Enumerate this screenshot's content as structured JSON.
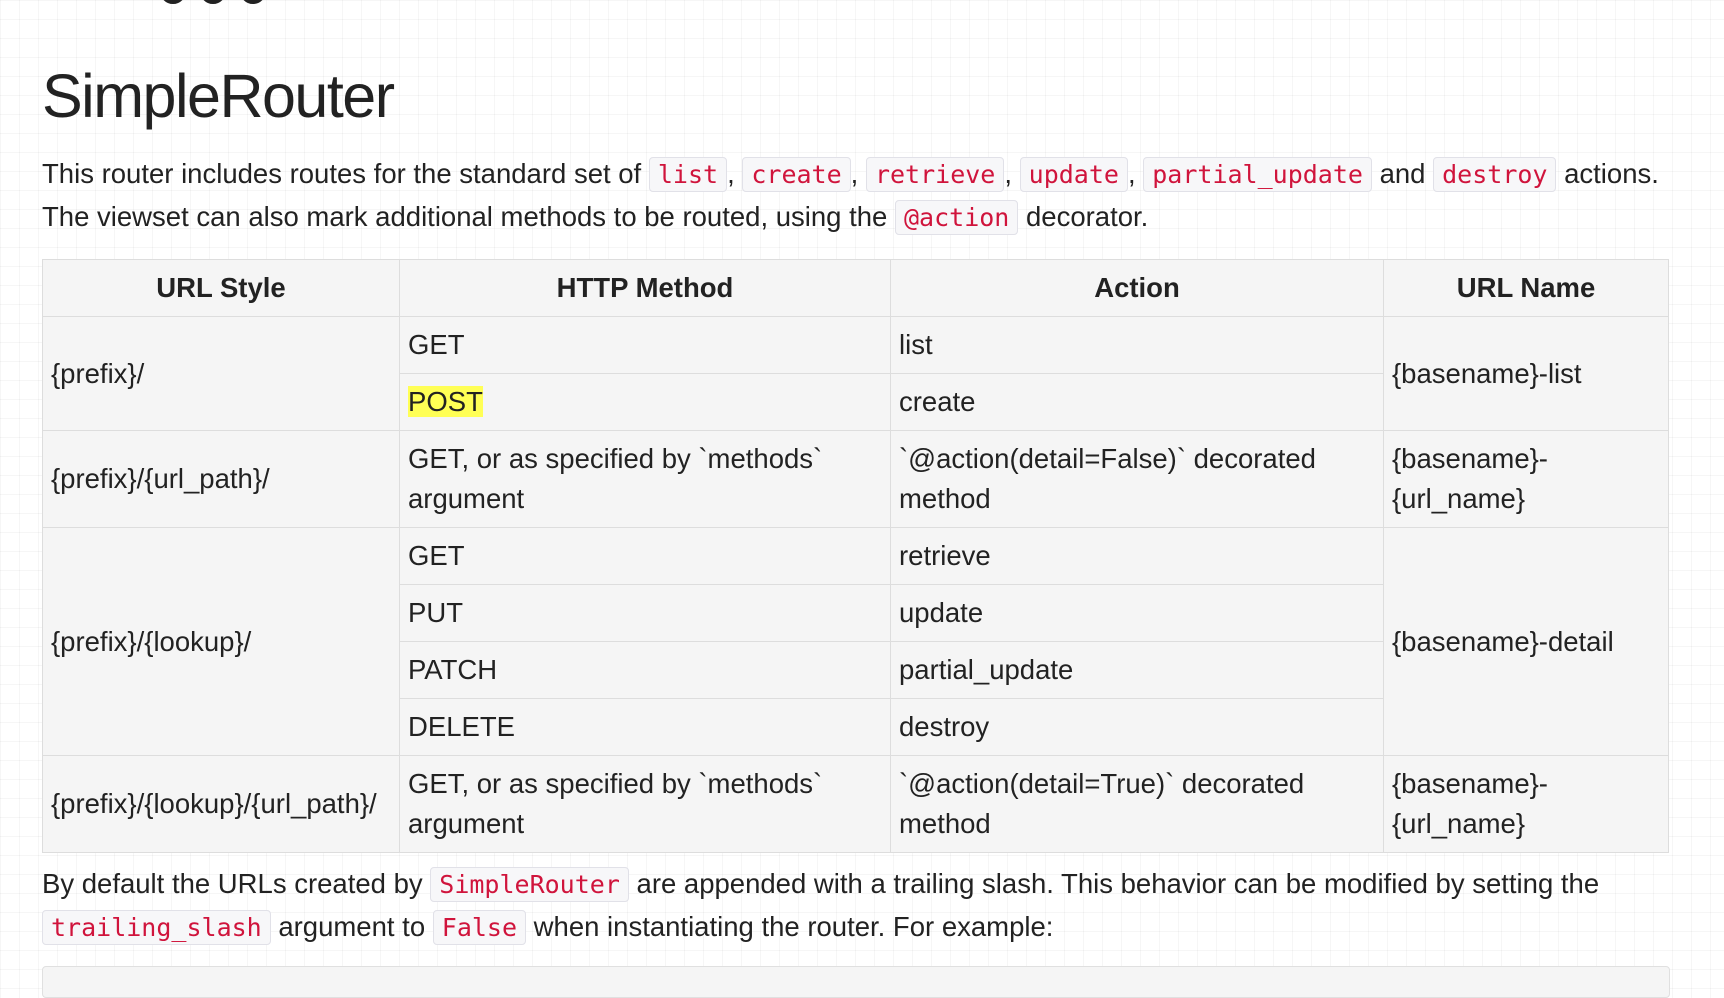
{
  "page": {
    "title": "SimpleRouter"
  },
  "intro": {
    "t1": "This router includes routes for the standard set of ",
    "c_list": "list",
    "s1": ", ",
    "c_create": "create",
    "s2": ", ",
    "c_retrieve": "retrieve",
    "s3": ", ",
    "c_update": "update",
    "s4": ", ",
    "c_partial": "partial_update",
    "and": " and ",
    "c_destroy": "destroy",
    "t2": " actions. The viewset can also mark additional methods to be routed, using the ",
    "c_action": "@action",
    "t3": " decorator."
  },
  "table": {
    "headers": [
      "URL Style",
      "HTTP Method",
      "Action",
      "URL Name"
    ],
    "r1": {
      "style": "{prefix}/",
      "m1": "GET",
      "a1": "list",
      "m2": "POST",
      "a2": "create",
      "name": "{basename}-list"
    },
    "r2": {
      "style": "{prefix}/{url_path}/",
      "method": "GET, or as specified by `methods` argument",
      "action": "`@action(detail=False)` decorated method",
      "name": "{basename}-{url_name}"
    },
    "r3": {
      "style": "{prefix}/{lookup}/",
      "m1": "GET",
      "a1": "retrieve",
      "m2": "PUT",
      "a2": "update",
      "m3": "PATCH",
      "a3": "partial_update",
      "m4": "DELETE",
      "a4": "destroy",
      "name": "{basename}-detail"
    },
    "r4": {
      "style": "{prefix}/{lookup}/{url_path}/",
      "method": "GET, or as specified by `methods` argument",
      "action": "`@action(detail=True)` decorated method",
      "name": "{basename}-{url_name}"
    }
  },
  "outro": {
    "t1": "By default the URLs created by ",
    "c_router": "SimpleRouter",
    "t2": " are appended with a trailing slash. This behavior can be modified by setting the ",
    "c_slash": "trailing_slash",
    "t3": " argument to ",
    "c_false": "False",
    "t4": " when instantiating the router. For example:"
  },
  "colors": {
    "code_text": "#d0143c",
    "highlight": "#ffff55",
    "table_bg": "#f5f5f5"
  }
}
